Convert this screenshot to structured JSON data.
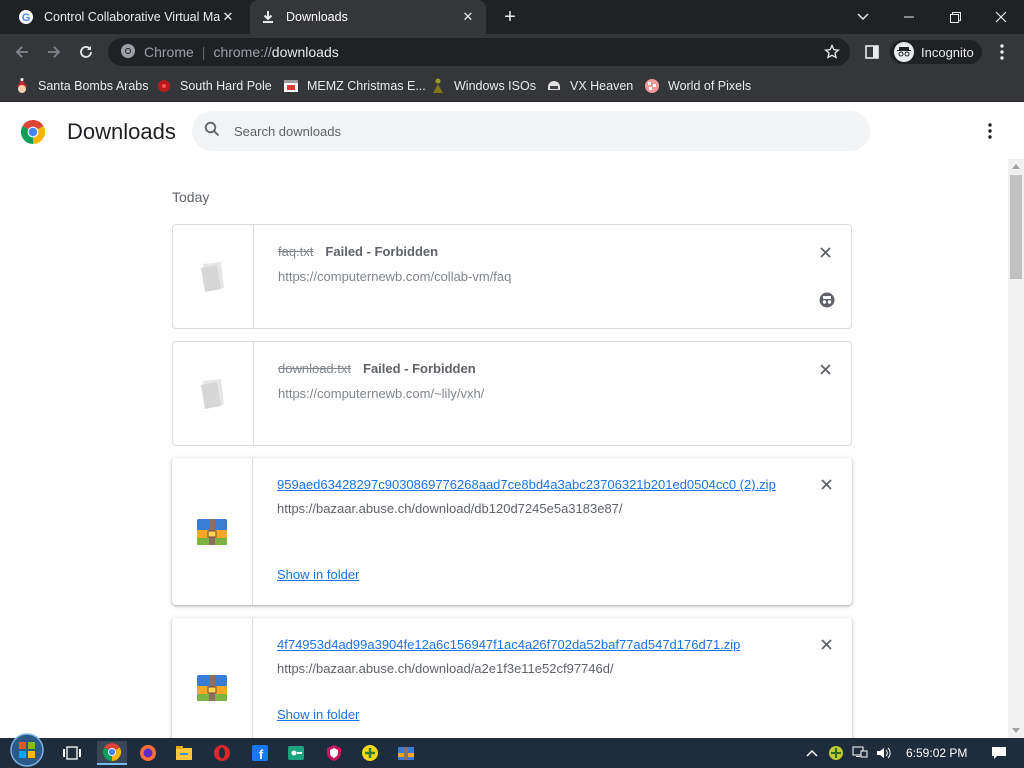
{
  "tabs": [
    {
      "title": "Control Collaborative Virtual Ma",
      "icon": "google-icon",
      "active": false
    },
    {
      "title": "Downloads",
      "icon": "download-icon",
      "active": true
    }
  ],
  "toolbar": {
    "site_label": "Chrome",
    "url_prefix": "chrome://",
    "url_main": "downloads",
    "incognito_label": "Incognito"
  },
  "bookmarks": [
    {
      "label": "Santa Bombs Arabs",
      "icon": "santa-icon"
    },
    {
      "label": "South Hard Pole",
      "icon": "bug-icon"
    },
    {
      "label": "MEMZ Christmas E...",
      "icon": "window-icon"
    },
    {
      "label": "Windows ISOs",
      "icon": "figure-icon"
    },
    {
      "label": "VX Heaven",
      "icon": "helmet-icon"
    },
    {
      "label": "World of Pixels",
      "icon": "pixels-icon"
    }
  ],
  "page": {
    "title": "Downloads",
    "search_placeholder": "Search downloads",
    "section_date": "Today"
  },
  "downloads": [
    {
      "filename": "faq.txt",
      "status": "Failed - Forbidden",
      "url": "https://computernewb.com/collab-vm/faq",
      "failed": true
    },
    {
      "filename": "download.txt",
      "status": "Failed - Forbidden",
      "url": "https://computernewb.com/~lily/vxh/",
      "failed": true
    },
    {
      "filename": "959aed63428297c9030869776268aad7ce8bd4a3abc23706321b201ed0504cc0 (2).zip",
      "url": "https://bazaar.abuse.ch/download/db120d7245e5a3183e87/",
      "action": "Show in folder",
      "failed": false
    },
    {
      "filename": "4f74953d4ad99a3904fe12a6c156947f1ac4a26f702da52baf77ad547d176d71.zip",
      "url": "https://bazaar.abuse.ch/download/a2e1f3e11e52cf97746d/",
      "action": "Show in folder",
      "failed": false
    }
  ],
  "taskbar": {
    "clock": "6:59:02 PM",
    "apps": [
      "start-icon",
      "task-view-icon",
      "chrome-icon",
      "firefox-icon",
      "file-explorer-icon",
      "opera-icon",
      "facebook-icon",
      "green-app-icon",
      "shield-app-icon",
      "yellow-plus-icon",
      "folder-app-icon"
    ]
  },
  "colors": {
    "link": "#1a73e8",
    "tabstrip": "#202124",
    "toolbar": "#35363a",
    "taskbar": "#1e2d3d"
  }
}
